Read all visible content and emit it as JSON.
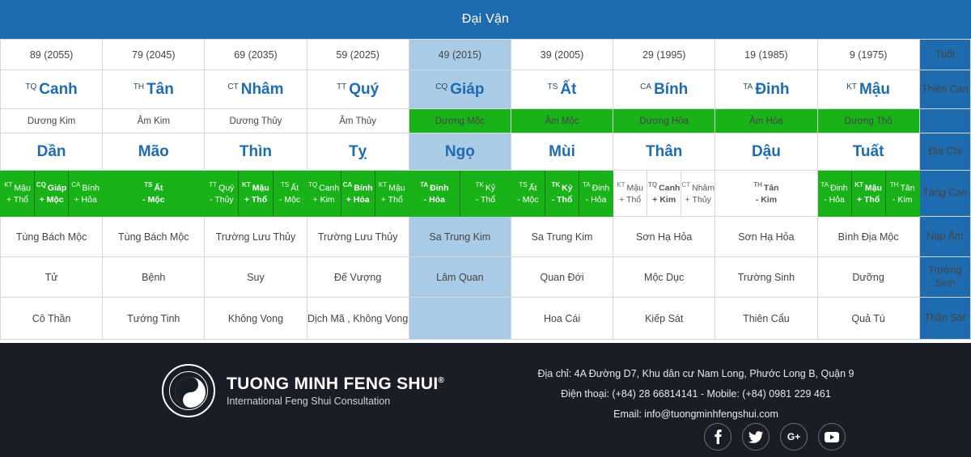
{
  "header": {
    "title": "Đại Vận"
  },
  "row_labels": {
    "tuoi": "Tuổi",
    "thien_can": "Thiên Can",
    "dia_chi": "Địa Chi",
    "tang_can": "Tàng Can",
    "nap_am": "Nạp Âm",
    "truong_sinh": "Trường Sinh",
    "than_sat": "Thần Sát"
  },
  "colors": {
    "header_blue": "#1e6bb0",
    "highlight_blue": "#a9cbe6",
    "green": "#19b319",
    "footer_dark": "#1b1d26",
    "stem_blue": "#1e6bb0"
  },
  "highlighted_column_index": 4,
  "columns": [
    {
      "tuoi": "89 (2055)",
      "thien_can_sup": "TQ",
      "thien_can": "Canh",
      "ngu_hanh_can": "Dương Kim",
      "ngu_hanh_can_green": false,
      "dia_chi": "Dần",
      "tang_can_green": true,
      "tang_can": [
        {
          "sup": "KT",
          "stem": "Mậu",
          "elem": "+ Thổ",
          "strong": false
        },
        {
          "sup": "CQ",
          "stem": "Giáp",
          "elem": "+ Mộc",
          "strong": true
        },
        {
          "sup": "CA",
          "stem": "Bính",
          "elem": "+ Hỏa",
          "strong": false
        }
      ],
      "nap_am": "Tùng Bách Mộc",
      "truong_sinh": "Tử",
      "than_sat": "Cô Thần"
    },
    {
      "tuoi": "79 (2045)",
      "thien_can_sup": "TH",
      "thien_can": "Tân",
      "ngu_hanh_can": "Âm Kim",
      "ngu_hanh_can_green": false,
      "dia_chi": "Mão",
      "tang_can_green": true,
      "tang_can": [
        {
          "sup": "TS",
          "stem": "Ất",
          "elem": "- Mộc",
          "strong": true
        }
      ],
      "nap_am": "Tùng Bách Mộc",
      "truong_sinh": "Bệnh",
      "than_sat": "Tướng Tinh"
    },
    {
      "tuoi": "69 (2035)",
      "thien_can_sup": "CT",
      "thien_can": "Nhâm",
      "ngu_hanh_can": "Dương Thủy",
      "ngu_hanh_can_green": false,
      "dia_chi": "Thìn",
      "tang_can_green": true,
      "tang_can": [
        {
          "sup": "TT",
          "stem": "Quý",
          "elem": "- Thủy",
          "strong": false
        },
        {
          "sup": "KT",
          "stem": "Mậu",
          "elem": "+ Thổ",
          "strong": true
        },
        {
          "sup": "TS",
          "stem": "Ất",
          "elem": "- Mộc",
          "strong": false
        }
      ],
      "nap_am": "Trường Lưu Thủy",
      "truong_sinh": "Suy",
      "than_sat": "Không Vong"
    },
    {
      "tuoi": "59 (2025)",
      "thien_can_sup": "TT",
      "thien_can": "Quý",
      "ngu_hanh_can": "Âm Thủy",
      "ngu_hanh_can_green": false,
      "dia_chi": "Tỵ",
      "tang_can_green": true,
      "tang_can": [
        {
          "sup": "TQ",
          "stem": "Canh",
          "elem": "+ Kim",
          "strong": false
        },
        {
          "sup": "CA",
          "stem": "Bính",
          "elem": "+ Hỏa",
          "strong": true
        },
        {
          "sup": "KT",
          "stem": "Mậu",
          "elem": "+ Thổ",
          "strong": false
        }
      ],
      "nap_am": "Trường Lưu Thủy",
      "truong_sinh": "Đế Vượng",
      "than_sat": "Dịch Mã , Không Vong"
    },
    {
      "tuoi": "49 (2015)",
      "thien_can_sup": "CQ",
      "thien_can": "Giáp",
      "ngu_hanh_can": "Dương Mộc",
      "ngu_hanh_can_green": true,
      "dia_chi": "Ngọ",
      "tang_can_green": true,
      "tang_can": [
        {
          "sup": "TA",
          "stem": "Đinh",
          "elem": "- Hỏa",
          "strong": true
        },
        {
          "sup": "TK",
          "stem": "Kỷ",
          "elem": "- Thổ",
          "strong": false
        }
      ],
      "nap_am": "Sa Trung Kim",
      "truong_sinh": "Lâm Quan",
      "than_sat": ""
    },
    {
      "tuoi": "39 (2005)",
      "thien_can_sup": "TS",
      "thien_can": "Ất",
      "ngu_hanh_can": "Âm Mộc",
      "ngu_hanh_can_green": true,
      "dia_chi": "Mùi",
      "tang_can_green": true,
      "tang_can": [
        {
          "sup": "TS",
          "stem": "Ất",
          "elem": "- Mộc",
          "strong": false
        },
        {
          "sup": "TK",
          "stem": "Kỷ",
          "elem": "- Thổ",
          "strong": true
        },
        {
          "sup": "TA",
          "stem": "Đinh",
          "elem": "- Hỏa",
          "strong": false
        }
      ],
      "nap_am": "Sa Trung Kim",
      "truong_sinh": "Quan Đới",
      "than_sat": "Hoa Cái"
    },
    {
      "tuoi": "29 (1995)",
      "thien_can_sup": "CA",
      "thien_can": "Bính",
      "ngu_hanh_can": "Dương Hỏa",
      "ngu_hanh_can_green": true,
      "dia_chi": "Thân",
      "tang_can_green": false,
      "tang_can": [
        {
          "sup": "KT",
          "stem": "Mậu",
          "elem": "+ Thổ",
          "strong": false
        },
        {
          "sup": "TQ",
          "stem": "Canh",
          "elem": "+ Kim",
          "strong": true
        },
        {
          "sup": "CT",
          "stem": "Nhâm",
          "elem": "+ Thủy",
          "strong": false
        }
      ],
      "nap_am": "Sơn Hạ Hỏa",
      "truong_sinh": "Mộc Dục",
      "than_sat": "Kiếp Sát"
    },
    {
      "tuoi": "19 (1985)",
      "thien_can_sup": "TA",
      "thien_can": "Đinh",
      "ngu_hanh_can": "Âm Hỏa",
      "ngu_hanh_can_green": true,
      "dia_chi": "Dậu",
      "tang_can_green": false,
      "tang_can": [
        {
          "sup": "TH",
          "stem": "Tân",
          "elem": "- Kim",
          "strong": true
        }
      ],
      "nap_am": "Sơn Hạ Hỏa",
      "truong_sinh": "Trường Sinh",
      "than_sat": "Thiên Cẩu"
    },
    {
      "tuoi": "9 (1975)",
      "thien_can_sup": "KT",
      "thien_can": "Mậu",
      "ngu_hanh_can": "Dương Thổ",
      "ngu_hanh_can_green": true,
      "dia_chi": "Tuất",
      "tang_can_green": true,
      "tang_can": [
        {
          "sup": "TA",
          "stem": "Đinh",
          "elem": "- Hỏa",
          "strong": false
        },
        {
          "sup": "KT",
          "stem": "Mậu",
          "elem": "+ Thổ",
          "strong": true
        },
        {
          "sup": "TH",
          "stem": "Tân",
          "elem": "- Kim",
          "strong": false
        }
      ],
      "nap_am": "Bình Địa Mộc",
      "truong_sinh": "Dưỡng",
      "than_sat": "Quả Tú"
    }
  ],
  "footer": {
    "brand_name": "TUONG MINH FENG SHUI",
    "brand_reg": "®",
    "brand_sub": "International Feng Shui Consultation",
    "logo_ring_top": "PHONG THUY TUONG MINH",
    "logo_ring_bottom": "INTERNATIONAL FENG SHUI",
    "address": "Địa chỉ: 4A Đường D7, Khu dân cư Nam Long, Phước Long B, Quận 9",
    "phone": "Điện thoại: (+84) 28 66814141 - Mobile: (+84) 0981 229 461",
    "email": "Email: info@tuongminhfengshui.com",
    "socials": [
      {
        "name": "facebook-icon",
        "glyph": "f"
      },
      {
        "name": "twitter-icon",
        "glyph": "t"
      },
      {
        "name": "google-plus-icon",
        "glyph": "G+"
      },
      {
        "name": "youtube-icon",
        "glyph": "yt"
      }
    ]
  }
}
